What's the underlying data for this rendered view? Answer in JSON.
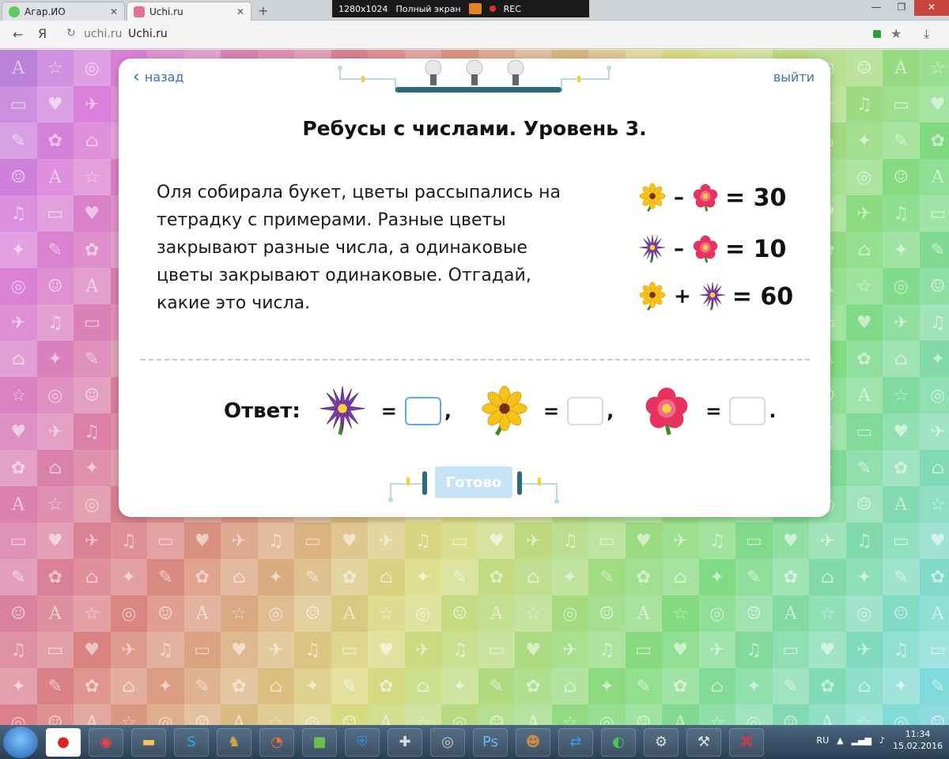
{
  "browser": {
    "tabs": [
      {
        "label": "Агар.ИО",
        "active": false,
        "favicon_color": "#5ec95e"
      },
      {
        "label": "Uchi.ru",
        "active": true,
        "favicon_color": "#e86e9a"
      }
    ],
    "new_tab_symbol": "+",
    "recorder": {
      "size": "1280x1024",
      "mode": "Полный экран",
      "rec": "REC"
    },
    "url_host": "uchi.ru",
    "url_title": "Uchi.ru",
    "ya_symbol": "Я"
  },
  "modal": {
    "back_label": "назад",
    "exit_label": "выйти",
    "title": "Ребусы с числами. Уровень 3.",
    "task_text": "Оля собирала букет, цветы рассыпались на тетрадку с примерами. Разные цветы закрывают разные числа, а одинаковые цветы закрывают одинаковые. Отгадай, какие это числа.",
    "equations": [
      {
        "a": "yellow-flower",
        "op": "–",
        "b": "pink-flower",
        "result": "= 30"
      },
      {
        "a": "purple-flower",
        "op": "–",
        "b": "pink-flower",
        "result": "= 10"
      },
      {
        "a": "yellow-flower",
        "op": "+",
        "b": "purple-flower",
        "result": "= 60"
      }
    ],
    "answer_label": "Ответ:",
    "answer_eq": "=",
    "answer_sep": ",",
    "answer_end": ".",
    "answers": [
      {
        "flower": "purple-flower",
        "value": ""
      },
      {
        "flower": "yellow-flower",
        "value": ""
      },
      {
        "flower": "pink-flower",
        "value": ""
      }
    ],
    "done_label": "Готово"
  },
  "colors": {
    "link": "#3c6fb3",
    "done_button": "#c5e3f5",
    "focus_border": "#5fa9e8",
    "flower_yellow": "#f7c21c",
    "flower_purple": "#7b3fa3",
    "flower_pink": "#e8335f"
  },
  "taskbar": {
    "lang": "RU",
    "time": "11:34",
    "date": "15.02.2016"
  }
}
